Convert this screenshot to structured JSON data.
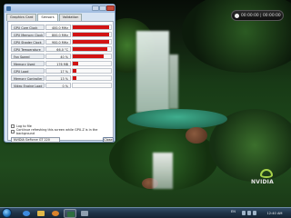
{
  "window": {
    "tabs": [
      "Graphics Card",
      "Sensors",
      "Validation"
    ],
    "active_tab_index": 1,
    "sensors": [
      {
        "label": "GPU Core Clock",
        "value": "400.0 MHz",
        "fill": 0.95
      },
      {
        "label": "GPU Memory Clock",
        "value": "800.0 MHz",
        "fill": 0.95
      },
      {
        "label": "GPU Shader Clock",
        "value": "900.0 MHz",
        "fill": 0.95
      },
      {
        "label": "GPU Temperature",
        "value": "66.0 °C",
        "fill": 0.9
      },
      {
        "label": "Fan Speed",
        "value": "40 %",
        "fill": 0.8
      },
      {
        "label": "Memory Used",
        "value": "176 MB",
        "fill": 0.15
      },
      {
        "label": "GPU Load",
        "value": "17 %",
        "fill": 0.1
      },
      {
        "label": "Memory Controller Load",
        "value": "13 %",
        "fill": 0.1
      },
      {
        "label": "Video Engine Load",
        "value": "0 %",
        "fill": 0.0
      }
    ],
    "options": [
      {
        "label": "Log to file",
        "checked": false
      },
      {
        "label": "Continue refreshing this screen while GPU-Z is in the background",
        "checked": false
      }
    ],
    "gpu_select": "NVIDIA GeForce GT 220",
    "close_label": "Close"
  },
  "widget": {
    "time": "00:00:00 | 00:00:00"
  },
  "watermark": {
    "brand": "NVIDIA"
  },
  "taskbar": {
    "lang": "EN",
    "clock": "12:40 AM"
  },
  "colors": {
    "sensor_fill": "#d21414",
    "nvidia_green": "#a7d24a"
  }
}
